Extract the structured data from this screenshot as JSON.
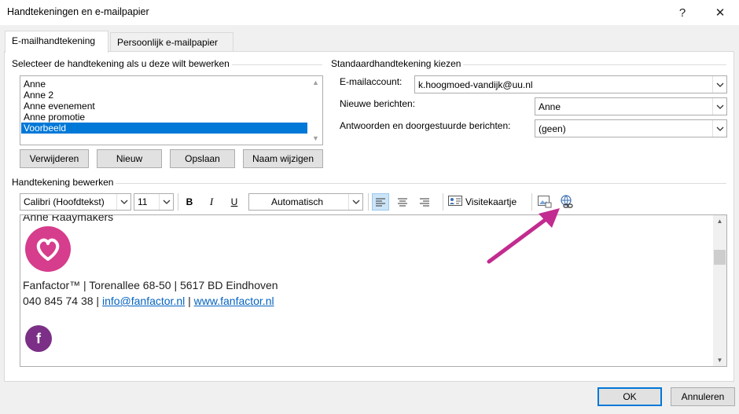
{
  "window": {
    "title": "Handtekeningen en e-mailpapier",
    "help_glyph": "?",
    "close_glyph": "✕"
  },
  "tabs": [
    {
      "label": "E-mailhandtekening",
      "active": true
    },
    {
      "label": "Persoonlijk e-mailpapier",
      "active": false
    }
  ],
  "select_group": {
    "label": "Selecteer de handtekening als u deze wilt bewerken",
    "items": [
      "Anne",
      "Anne 2",
      "Anne evenement",
      "Anne promotie",
      "Voorbeeld"
    ],
    "selected_index": 4
  },
  "list_buttons": {
    "delete": "Verwijderen",
    "new": "Nieuw",
    "save": "Opslaan",
    "rename": "Naam wijzigen"
  },
  "default_group": {
    "label": "Standaardhandtekening kiezen",
    "email_account_label": "E-mailaccount:",
    "email_account_value": "k.hoogmoed-vandijk@uu.nl",
    "new_messages_label": "Nieuwe berichten:",
    "new_messages_value": "Anne",
    "replies_label": "Antwoorden en doorgestuurde berichten:",
    "replies_value": "(geen)"
  },
  "edit_group": {
    "label": "Handtekening bewerken"
  },
  "toolbar": {
    "font": "Calibri (Hoofdtekst)",
    "size": "11",
    "bold": "B",
    "italic": "I",
    "underline": "U",
    "color": "Automatisch",
    "business_card": "Visitekaartje"
  },
  "editor": {
    "name_line": "Anne Raaymakers",
    "address_line": "Fanfactor™ | Torenallee 68-50 | 5617 BD Eindhoven",
    "phone": "040 845 74 38",
    "separator": " | ",
    "email_link": "info@fanfactor.nl",
    "web_link": "www.fanfactor.nl",
    "facebook_glyph": "f"
  },
  "footer": {
    "ok": "OK",
    "cancel": "Annuleren"
  },
  "colors": {
    "selection": "#0078d7",
    "link": "#0563c1",
    "logo": "#d63d8c",
    "facebook_badge": "#7b2f86",
    "annotation_arrow": "#c22b8f"
  }
}
